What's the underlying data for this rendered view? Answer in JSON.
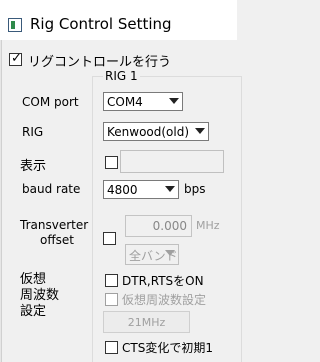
{
  "window": {
    "title": "Rig Control Setting",
    "app_icon": "app-window-icon"
  },
  "enable": {
    "label": "リグコントロールを行う",
    "checked": true
  },
  "group": {
    "caption": "RIG 1"
  },
  "com_port": {
    "label": "COM port",
    "value": "COM4"
  },
  "rig": {
    "label": "RIG",
    "value": "Kenwood(old)"
  },
  "display": {
    "label": "表示",
    "checked": false,
    "value": ""
  },
  "baud_rate": {
    "label": "baud rate",
    "value": "4800",
    "unit": "bps"
  },
  "transverter": {
    "label_line1": "Transverter",
    "label_line2": "offset",
    "checked": false,
    "offset": "0.000",
    "unit": "MHz",
    "band": "全バンド"
  },
  "virtual_freq": {
    "label_line1": "仮想",
    "label_line2": "周波数",
    "label_line3": "設定",
    "dtr_rts": {
      "label": "DTR,RTSをON",
      "checked": false
    },
    "setting": {
      "label": "仮想周波数設定",
      "checked": false
    },
    "freq_button": "21MHz"
  },
  "cts": {
    "label": "CTS変化で初期1",
    "checked": false
  }
}
